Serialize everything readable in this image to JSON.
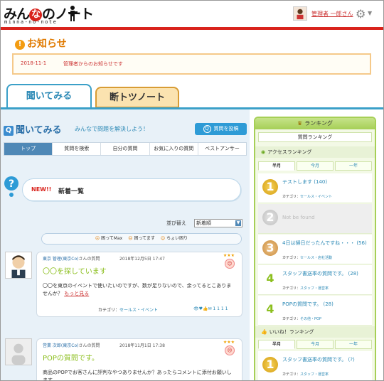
{
  "header": {
    "logo": {
      "pre": "みん",
      "circle": "な",
      "post": "のノート",
      "sub": "minna-no-note"
    },
    "user_name": "管理者 一郎さん",
    "accent_color": "#d9231c"
  },
  "notice": {
    "title": "お知らせ",
    "items": [
      {
        "date": "2018-11-1",
        "text": "管理者からのお知らせです"
      }
    ]
  },
  "main_tabs": [
    {
      "label": "聞いてみる"
    },
    {
      "label": "断トツノート"
    }
  ],
  "section": {
    "title": "聞いてみる",
    "subtitle": "みんなで問題を解決しよう！",
    "ask_button": "質問を投稿"
  },
  "sub_tabs": [
    "トップ",
    "質問を検索",
    "自分の質問",
    "お気に入りの質問",
    "ベストアンサー"
  ],
  "new_bar": {
    "tag": "NEW!!",
    "label": "新着一覧"
  },
  "sort": {
    "label": "並び替え",
    "value": "新着順"
  },
  "filters": [
    "困ってMax",
    "困ってます",
    "ちょい困り"
  ],
  "posts": [
    {
      "user": "東京 管理(東京Co)",
      "suffix": "さんの質問",
      "date": "2018年12月5日 17:47",
      "title": "〇〇を探しています",
      "body": "〇〇を東京のイベントで使いたいのですが、数が足りないので、余ってるとこありませんか？",
      "more": "もっと見る",
      "category_label": "カテゴリ：",
      "category": "セールス・イベント",
      "stats": "1 1 1 1",
      "stars": "★★★",
      "face": "☹"
    },
    {
      "user": "営業 次郎(東京Co)",
      "suffix": "さんの質問",
      "date": "2018年11月1日 17:38",
      "title": "POPの質問です。",
      "body": "商品のPOPでお客さんに評判なやつありませんか？あったらコメントに添付お願いします。",
      "stars": "★★★",
      "face": "☹"
    }
  ],
  "ranking": {
    "title": "ランキング",
    "sub": "質問ランキング",
    "access": {
      "title": "アクセスランキング",
      "tabs": [
        "半月",
        "今月",
        "一年"
      ],
      "items": [
        {
          "rank": "1",
          "title": "テストします (140)",
          "category": "セールス・イベント"
        },
        {
          "rank": "2",
          "title": "Not be found",
          "category": ""
        },
        {
          "rank": "3",
          "title": "4日は掃日だったんですね・・・ (56)",
          "category": "セールス・店社活動"
        },
        {
          "rank": "4",
          "title": "スタッフ書送率の質問です。 (28)",
          "category": "スタッフ・運営率"
        },
        {
          "rank": "4",
          "title": "POPの質問です。 (28)",
          "category": "その他・POP"
        }
      ]
    },
    "iine": {
      "title": "いいね！ランキング",
      "tabs": [
        "半月",
        "今月",
        "一年"
      ],
      "items": [
        {
          "rank": "1",
          "title": "スタッフ書送率の質問です。 (?)",
          "category": "スタッフ・運営率"
        }
      ]
    },
    "category_label": "カテゴリ："
  }
}
